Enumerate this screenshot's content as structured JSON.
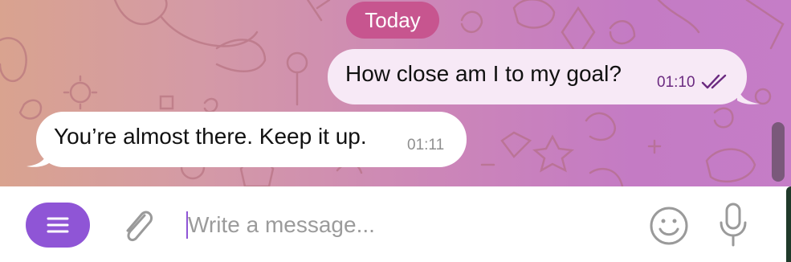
{
  "chat": {
    "date_label": "Today",
    "messages": [
      {
        "direction": "outgoing",
        "text": "How close am I to my goal?",
        "time": "01:10",
        "status": "read"
      },
      {
        "direction": "incoming",
        "text": "You’re almost there. Keep it up.",
        "time": "01:11"
      }
    ]
  },
  "composer": {
    "placeholder": "Write a message...",
    "value": ""
  },
  "icons": {
    "menu": "menu-icon",
    "attach": "paperclip-icon",
    "emoji": "smiley-icon",
    "mic": "microphone-icon",
    "read_status": "double-check-icon"
  },
  "colors": {
    "menu_button": "#8f55d6",
    "date_pill": "#c7558f",
    "outgoing_bubble": "#f7e9f6",
    "incoming_bubble": "#ffffff",
    "outgoing_time": "#6b2a80"
  }
}
